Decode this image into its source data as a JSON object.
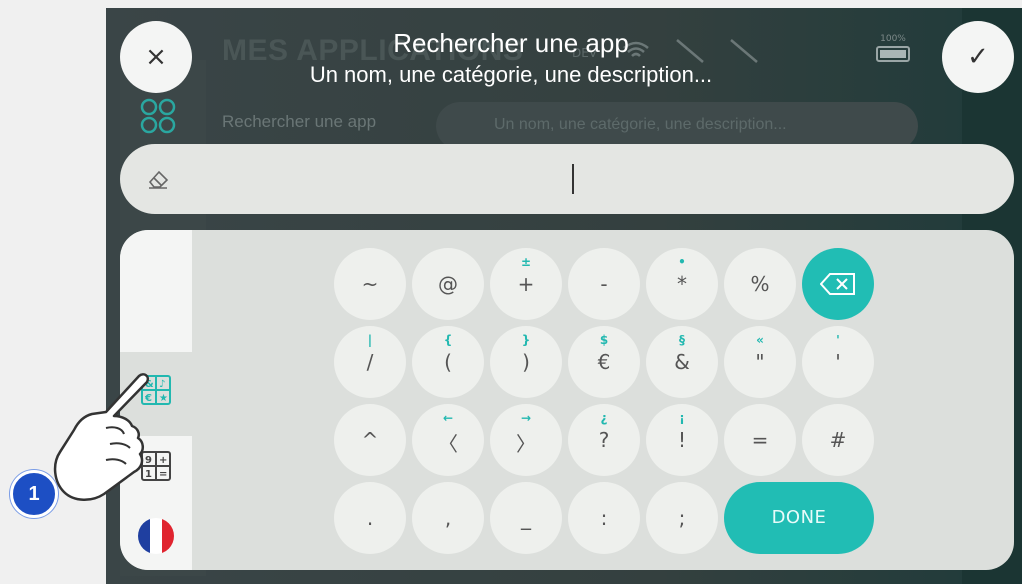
{
  "background_app": {
    "title": "MES APPLICATIONS",
    "search_label": "Rechercher une app",
    "search_placeholder": "Un nom, une catégorie, une description...",
    "status": {
      "dev_badge": "DEV",
      "battery_label": "100%"
    }
  },
  "overlay": {
    "title": "Rechercher une app",
    "subtitle": "Un nom, une catégorie, une description..."
  },
  "buttons": {
    "close_icon": "×",
    "confirm_icon": "✓"
  },
  "search_field": {
    "value": ""
  },
  "keyboard": {
    "side_tabs": [
      "symbols",
      "numbers",
      "language-fr"
    ],
    "rows": [
      [
        {
          "sec": "",
          "main": "~"
        },
        {
          "sec": "",
          "main": "@"
        },
        {
          "sec": "±",
          "main": "+"
        },
        {
          "sec": "",
          "main": "-"
        },
        {
          "sec": "•",
          "main": "*"
        },
        {
          "sec": "",
          "main": "%"
        }
      ],
      [
        {
          "sec": "|",
          "main": "/"
        },
        {
          "sec": "{",
          "main": "("
        },
        {
          "sec": "}",
          "main": ")"
        },
        {
          "sec": "$",
          "main": "€"
        },
        {
          "sec": "§",
          "main": "&"
        },
        {
          "sec": "«",
          "main": "\""
        },
        {
          "sec": "'",
          "main": "'"
        }
      ],
      [
        {
          "sec": "",
          "main": "^"
        },
        {
          "sec": "←",
          "main": "〈"
        },
        {
          "sec": "→",
          "main": "〉"
        },
        {
          "sec": "¿",
          "main": "?"
        },
        {
          "sec": "¡",
          "main": "!"
        },
        {
          "sec": "",
          "main": "="
        },
        {
          "sec": "",
          "main": "#"
        }
      ],
      [
        {
          "sec": "",
          "main": "."
        },
        {
          "sec": "",
          "main": ","
        },
        {
          "sec": "",
          "main": "_"
        },
        {
          "sec": "",
          "main": ":"
        },
        {
          "sec": "",
          "main": ";"
        }
      ]
    ],
    "done_label": "DONE"
  },
  "tutorial": {
    "step_number": "1"
  },
  "colors": {
    "accent": "#21bdb4",
    "badge": "#1d4fc4"
  }
}
